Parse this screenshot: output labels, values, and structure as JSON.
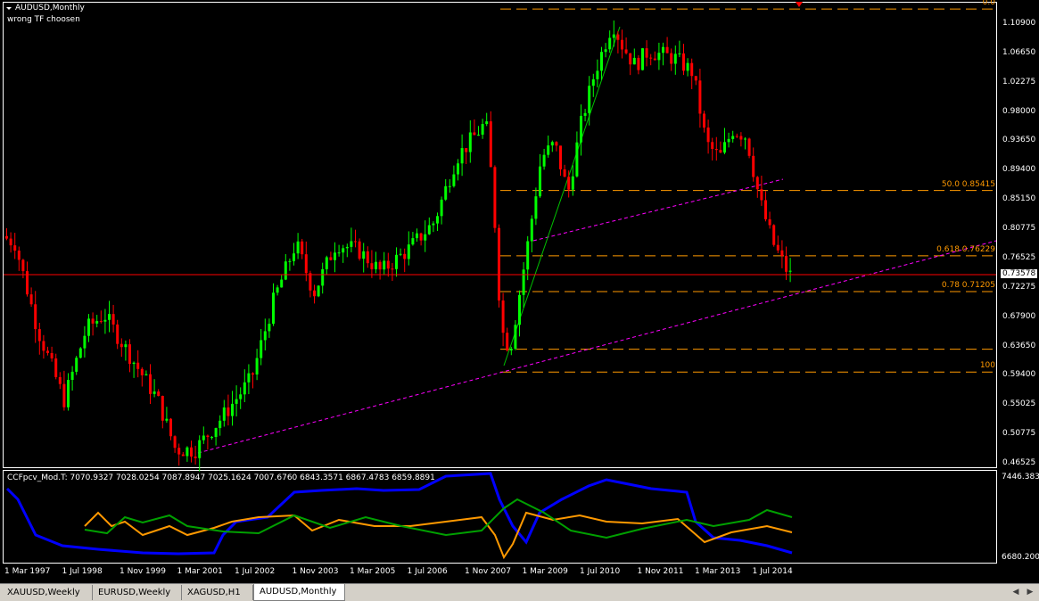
{
  "chart": {
    "symbol_title": "AUDUSD,Monthly",
    "warning": "wrong TF choosen",
    "current_price": "0.73578",
    "price_axis_labels": [
      "1.10900",
      "1.06650",
      "1.02275",
      "0.98000",
      "0.93650",
      "0.89400",
      "0.85150",
      "0.80775",
      "0.76525",
      "0.72275",
      "0.67900",
      "0.63650",
      "0.59400",
      "0.55025",
      "0.50775",
      "0.46525"
    ],
    "time_axis_labels": [
      "1 Mar 1997",
      "1 Jul 1998",
      "1 Nov 1999",
      "1 Mar 2001",
      "1 Jul 2002",
      "1 Nov 2003",
      "1 Mar 2005",
      "1 Jul 2006",
      "1 Nov 2007",
      "1 Mar 2009",
      "1 Jul 2010",
      "1 Nov 2011",
      "1 Mar 2013",
      "1 Jul 2014"
    ],
    "fib_levels": [
      {
        "label": "0.0",
        "price": 1.109
      },
      {
        "label": "50.0 0.85415",
        "price": 0.85415
      },
      {
        "label": "0.618 0.76229",
        "price": 0.76229
      },
      {
        "label": "0.78 0.71205",
        "price": 0.71205
      },
      {
        "label": "",
        "price": 0.631
      },
      {
        "label": "100",
        "price": 0.599
      }
    ],
    "y_range": [
      0.4652,
      1.118
    ],
    "colors": {
      "bull": "#00ff00",
      "bear": "#ff0000",
      "fib": "#ff9900",
      "trend": "#ff00ff",
      "price_line": "#ff0000",
      "grid_border": "#ffffff"
    }
  },
  "indicator": {
    "label": "CCFpcv_Mod.T: 7070.9327 7028.0254 7087.8947 7025.1624 7007.6760 6843.3571 6867.4783 6859.8891",
    "axis_top": "7446.3838",
    "axis_bottom": "6680.2003",
    "colors": {
      "blue": "#0000ff",
      "orange": "#ff9900",
      "green": "#00a000"
    }
  },
  "tabs": [
    {
      "label": "XAUUSD,Weekly",
      "active": false
    },
    {
      "label": "EURUSD,Weekly",
      "active": false
    },
    {
      "label": "XAGUSD,H1",
      "active": false
    },
    {
      "label": "AUDUSD,Monthly",
      "active": true
    }
  ]
}
